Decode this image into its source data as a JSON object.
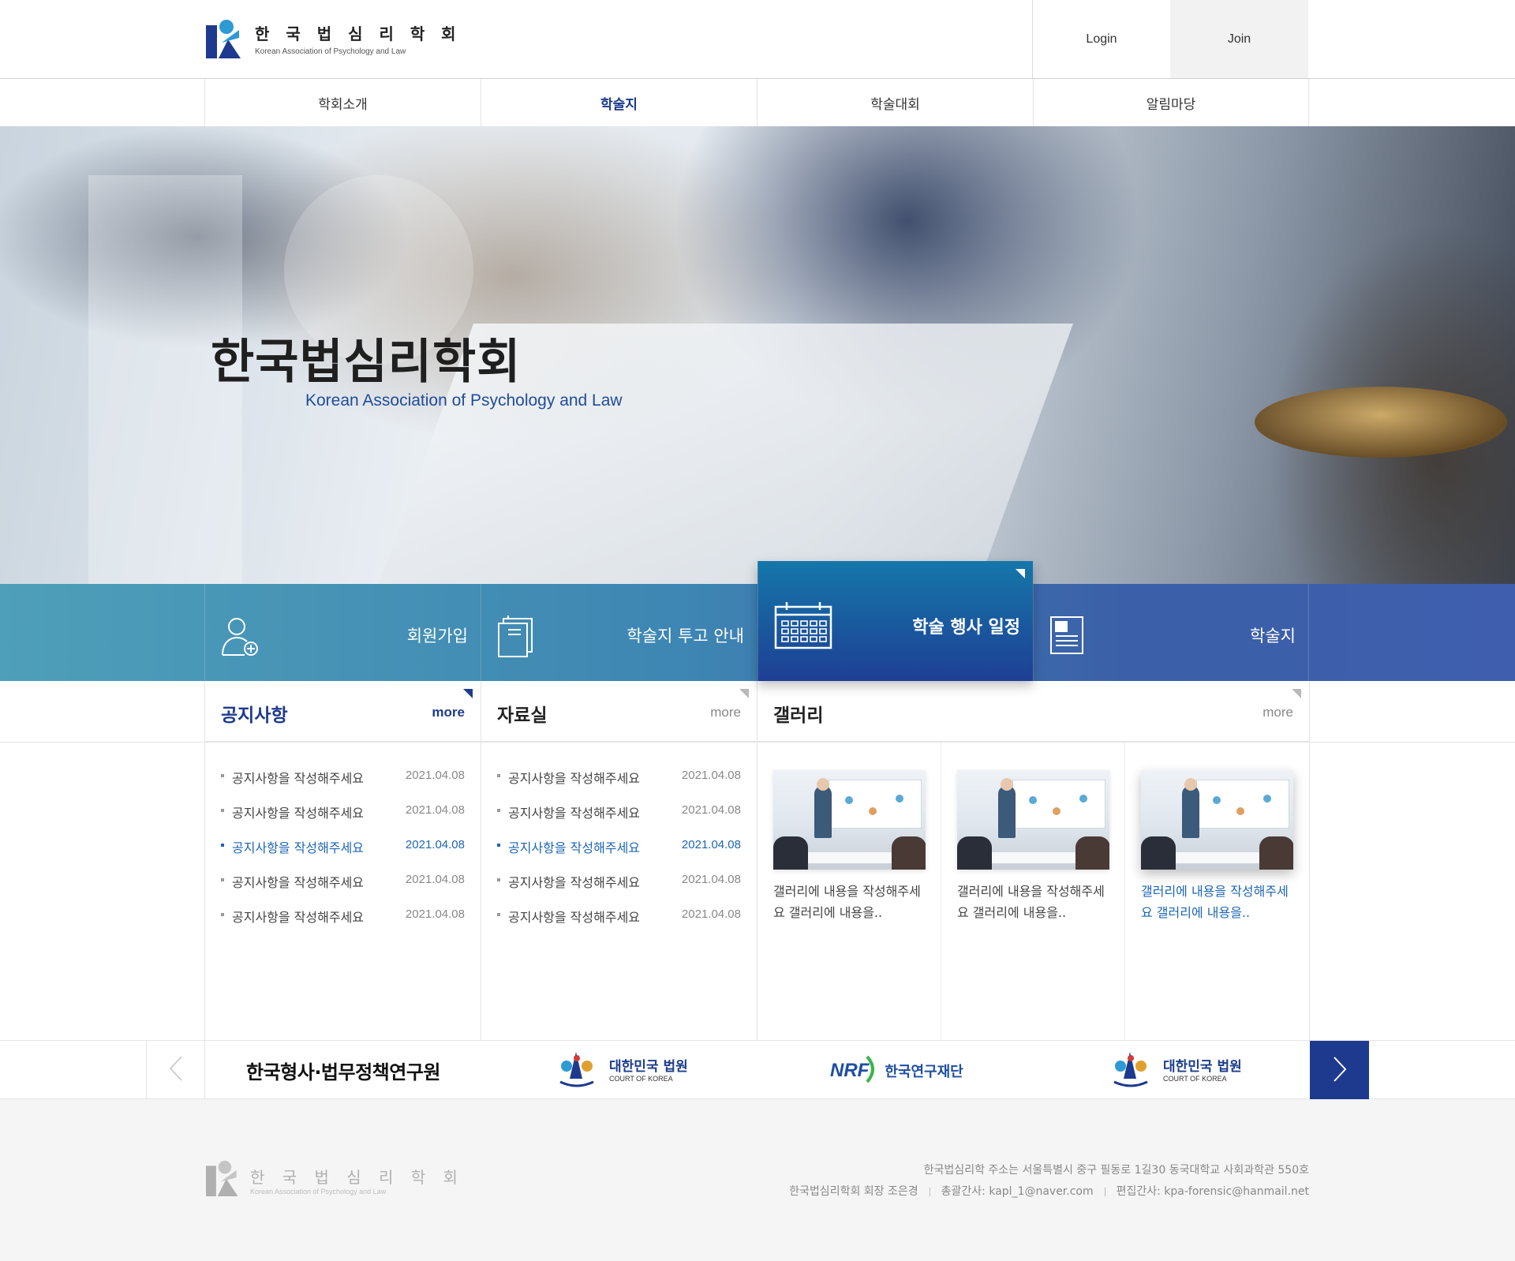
{
  "header": {
    "logo_title": "한 국 법 심 리 학 회",
    "logo_sub": "Korean Association of Psychology and Law",
    "login": "Login",
    "join": "Join"
  },
  "nav": {
    "items": [
      {
        "label": "학회소개"
      },
      {
        "label": "학술지"
      },
      {
        "label": "학술대회"
      },
      {
        "label": "알림마당"
      }
    ],
    "active_index": 1
  },
  "hero": {
    "title": "한국법심리학회",
    "subtitle": "Korean Association of Psychology and Law"
  },
  "quick": {
    "items": [
      {
        "label": "회원가입",
        "icon": "user-plus-icon"
      },
      {
        "label": "학술지 투고 안내",
        "icon": "documents-icon"
      },
      {
        "label": "학술 행사 일정",
        "icon": "calendar-icon"
      },
      {
        "label": "학술지",
        "icon": "journal-icon"
      }
    ]
  },
  "notice": {
    "title": "공지사항",
    "more": "more",
    "rows": [
      {
        "text": "공지사항을 작성해주세요",
        "date": "2021.04.08"
      },
      {
        "text": "공지사항을 작성해주세요",
        "date": "2021.04.08"
      },
      {
        "text": "공지사항을 작성해주세요",
        "date": "2021.04.08"
      },
      {
        "text": "공지사항을 작성해주세요",
        "date": "2021.04.08"
      },
      {
        "text": "공지사항을 작성해주세요",
        "date": "2021.04.08"
      }
    ]
  },
  "archive": {
    "title": "자료실",
    "more": "more",
    "rows": [
      {
        "text": "공지사항을 작성해주세요",
        "date": "2021.04.08"
      },
      {
        "text": "공지사항을 작성해주세요",
        "date": "2021.04.08"
      },
      {
        "text": "공지사항을 작성해주세요",
        "date": "2021.04.08"
      },
      {
        "text": "공지사항을 작성해주세요",
        "date": "2021.04.08"
      },
      {
        "text": "공지사항을 작성해주세요",
        "date": "2021.04.08"
      }
    ]
  },
  "gallery": {
    "title": "갤러리",
    "more": "more",
    "items": [
      {
        "caption": "갤러리에 내용을 작성해주세요 갤러리에 내용을.."
      },
      {
        "caption": "갤러리에 내용을 작성해주세요 갤러리에 내용을.."
      },
      {
        "caption": "갤러리에 내용을 작성해주세요 갤러리에 내용을.."
      }
    ]
  },
  "partners": {
    "items": [
      {
        "name": "한국형사·법무정책연구원"
      },
      {
        "name": "대한민국 법원",
        "sub": "COURT OF KOREA",
        "emblem_text": "대한민국법원"
      },
      {
        "name": "한국연구재단",
        "logo": "NRF"
      },
      {
        "name": "대한민국 법원",
        "sub": "COURT OF KOREA",
        "emblem_text": "대한민국법원"
      }
    ]
  },
  "footer": {
    "logo_title": "한 국 법 심 리 학 회",
    "logo_sub": "Korean Association of Psychology and Law",
    "address": "한국법심리학 주소는 서울특별시 중구 필동로 1길30 동국대학교 사회과학관 550호",
    "president": "한국법심리학회 회장 조은경",
    "secretary": "총괄간사: kapl_1@naver.com",
    "editor": "편집간사: kpa-forensic@hanmail.net"
  },
  "colors": {
    "brand_navy": "#1d3a8e",
    "highlight_blue": "#1d66b4",
    "quick_teal": "#4e9fb9",
    "quick_blue": "#3f5fae"
  }
}
